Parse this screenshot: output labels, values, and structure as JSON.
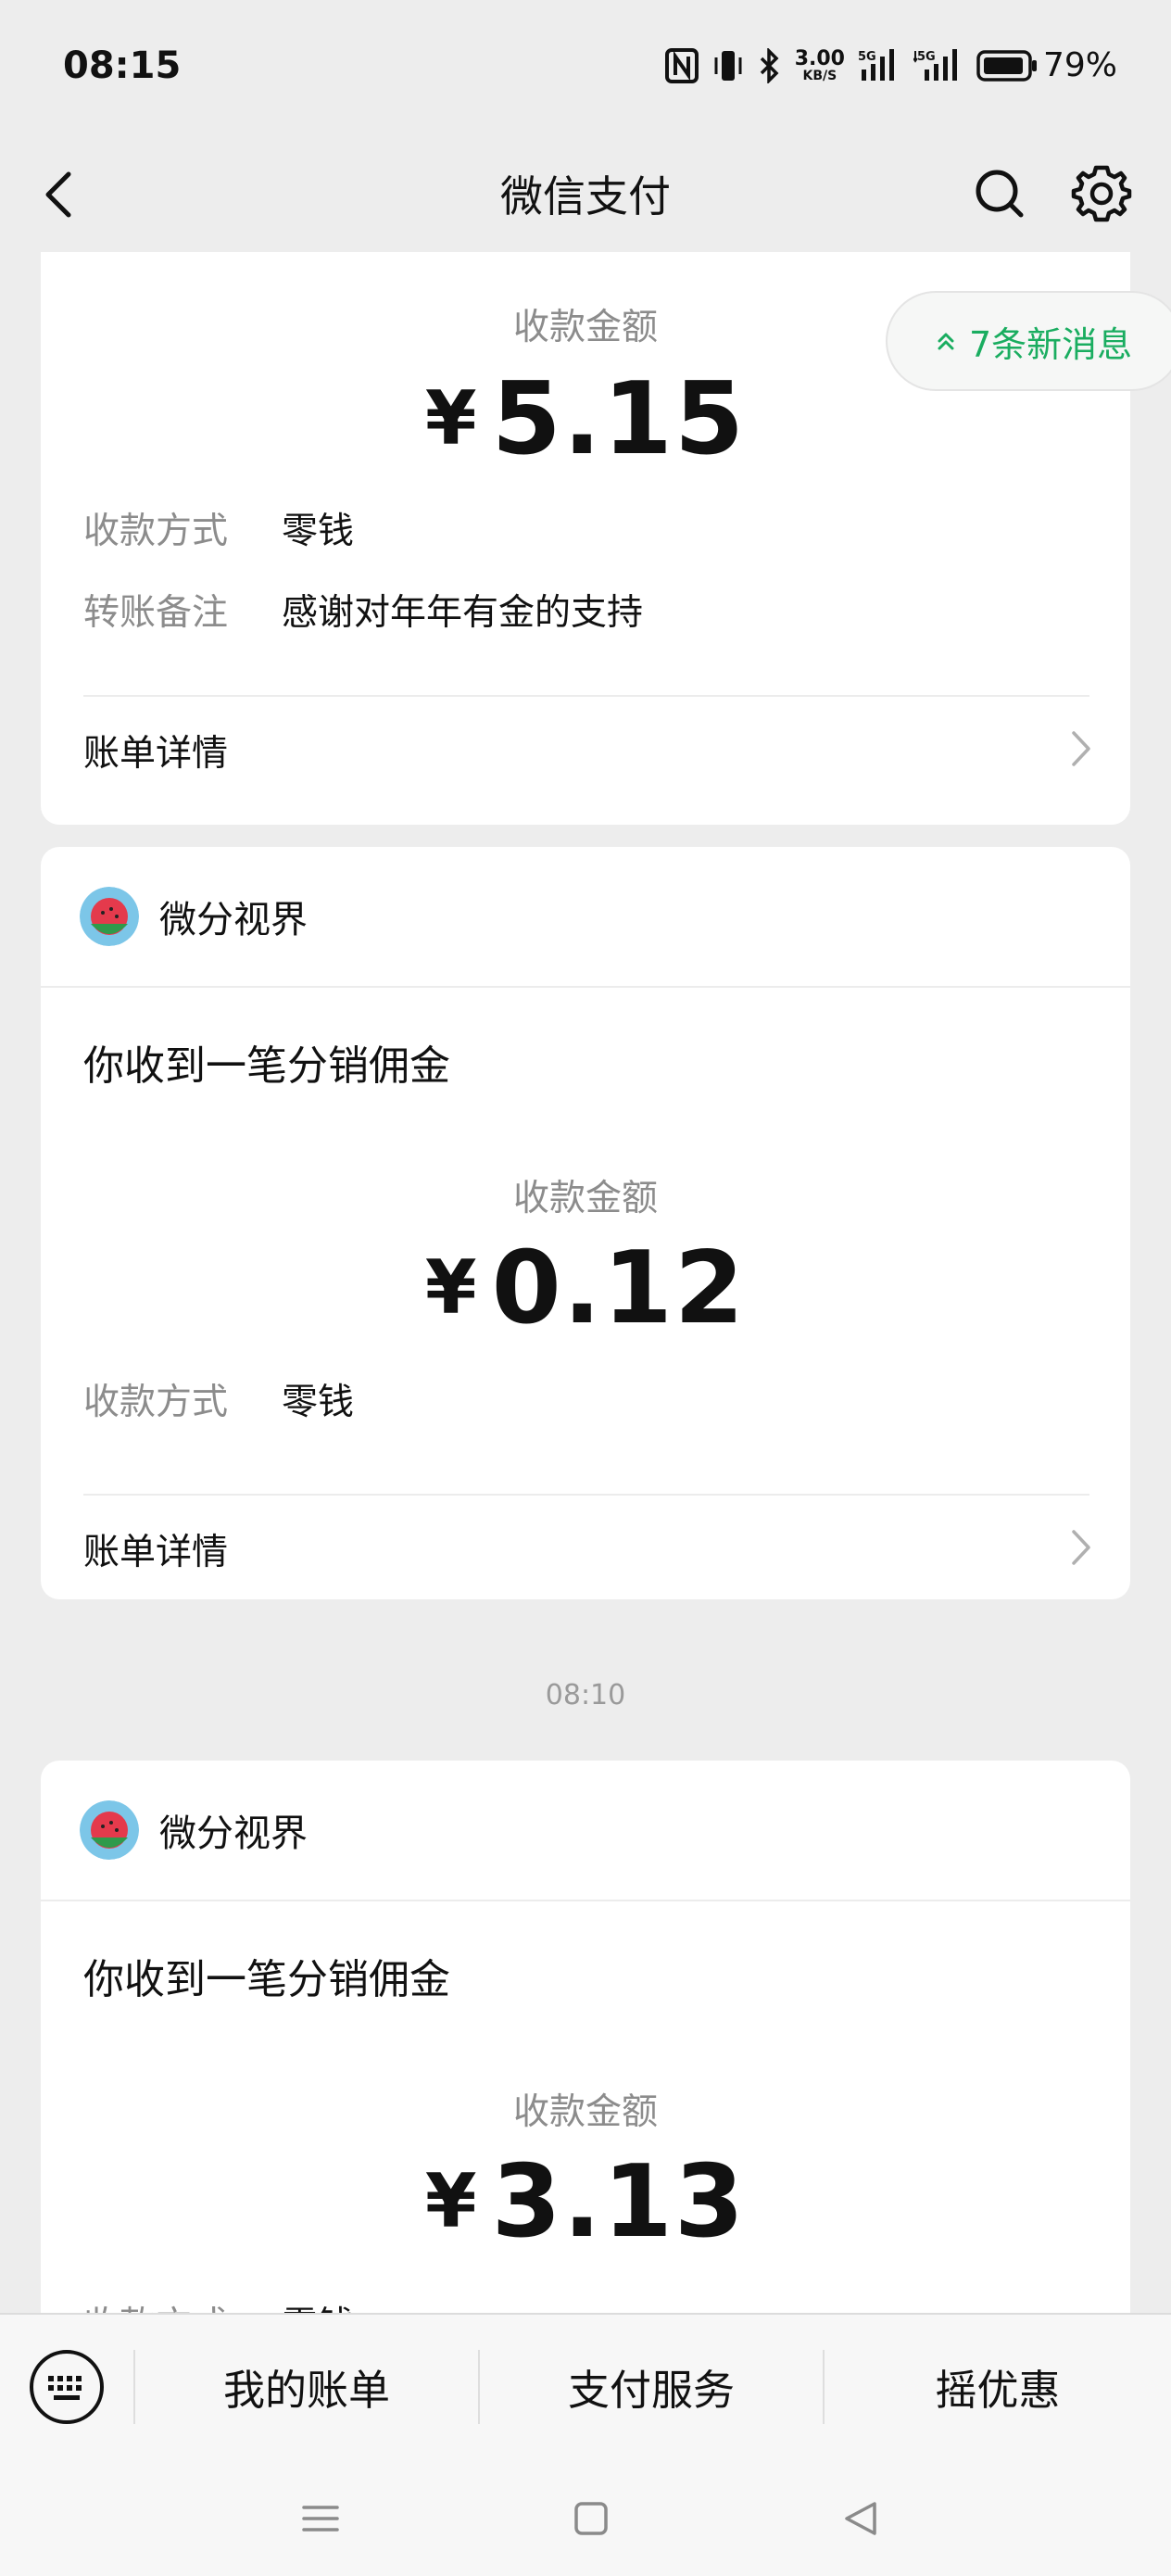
{
  "status_bar": {
    "time": "08:15",
    "net_speed_value": "3.00",
    "net_speed_unit": "KB/S",
    "network_1": "5G",
    "network_2": "5G",
    "battery": "79%"
  },
  "nav": {
    "title": "微信支付"
  },
  "new_messages": "7条新消息",
  "cards": [
    {
      "amount_label": "收款金额",
      "currency": "¥",
      "amount": "5.15",
      "rows": [
        {
          "key": "收款方式",
          "value": "零钱"
        },
        {
          "key": "转账备注",
          "value": "感谢对年年有金的支持"
        }
      ],
      "details_label": "账单详情"
    },
    {
      "sender": "微分视界",
      "title": "你收到一笔分销佣金",
      "amount_label": "收款金额",
      "currency": "¥",
      "amount": "0.12",
      "rows": [
        {
          "key": "收款方式",
          "value": "零钱"
        }
      ],
      "details_label": "账单详情"
    },
    {
      "timestamp": "08:10",
      "sender": "微分视界",
      "title": "你收到一笔分销佣金",
      "amount_label": "收款金额",
      "currency": "¥",
      "amount": "3.13",
      "rows": [
        {
          "key": "收款方式",
          "value": "零钱"
        }
      ]
    }
  ],
  "bottom_menu": [
    "我的账单",
    "支付服务",
    "摇优惠"
  ],
  "colors": {
    "accent_green": "#1aad60",
    "background": "#ededed"
  }
}
